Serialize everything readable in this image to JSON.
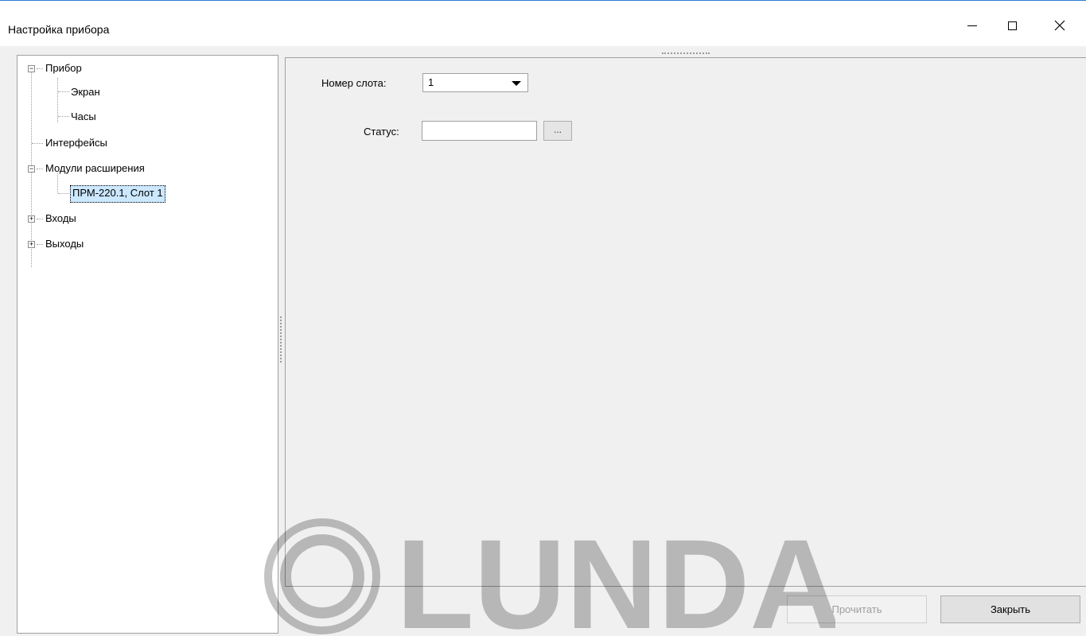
{
  "window": {
    "title": "Настройка прибора",
    "controls": {
      "minimize": "minimize-icon",
      "maximize": "maximize-icon",
      "close": "close-icon"
    }
  },
  "tree": {
    "nodes": [
      {
        "label": "Прибор",
        "expander": "−"
      },
      {
        "label": "Экран"
      },
      {
        "label": "Часы"
      },
      {
        "label": "Интерфейсы"
      },
      {
        "label": "Модули расширения",
        "expander": "−"
      },
      {
        "label": "ПРМ-220.1, Слот 1",
        "selected": true
      },
      {
        "label": "Входы",
        "expander": "+"
      },
      {
        "label": "Выходы",
        "expander": "+"
      }
    ]
  },
  "form": {
    "slot_label": "Номер слота:",
    "slot_value": "1",
    "status_label": "Статус:",
    "status_value": "",
    "ellipsis": "..."
  },
  "buttons": {
    "read": "Прочитать",
    "close": "Закрыть"
  },
  "watermark": {
    "text": "LUNDA"
  },
  "colors": {
    "window_border": "#2b7bd4",
    "selection": "#cce8ff",
    "background": "#f0f0f0"
  }
}
